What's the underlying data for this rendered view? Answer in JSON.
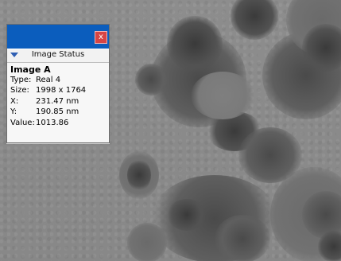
{
  "window": {
    "close_glyph": "x",
    "title": "Image Status"
  },
  "image": {
    "name": "Image A",
    "fields": [
      {
        "key": "Type:",
        "value": "Real 4"
      },
      {
        "key": "Size:",
        "value": "1998 x 1764"
      },
      {
        "key": "X:",
        "value": "231.47 nm"
      },
      {
        "key": "Y:",
        "value": "190.85 nm"
      },
      {
        "key": "Value:",
        "value": "1013.86"
      }
    ]
  },
  "icons": {
    "close": "close-icon",
    "collapse": "triangle-down-icon"
  },
  "colors": {
    "titlebar": "#0b5dbd",
    "close_button": "#d64545",
    "background_micrograph": "#8a8a8a"
  }
}
